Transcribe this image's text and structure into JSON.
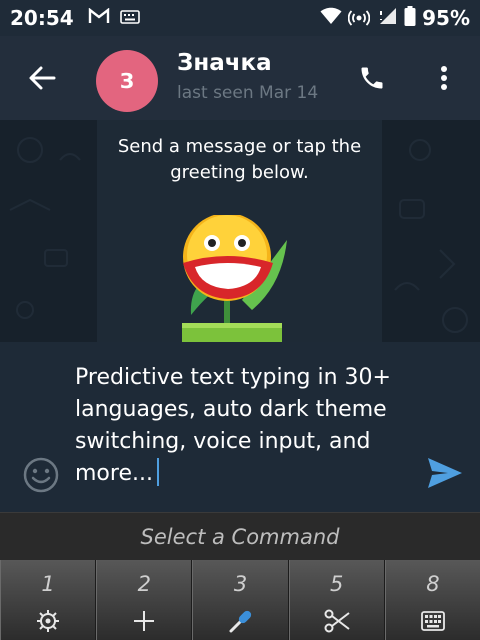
{
  "status_bar": {
    "time": "20:54",
    "battery": "95%",
    "icons": [
      "gmail-icon",
      "keyboard-icon",
      "wifi-icon",
      "hotspot-icon",
      "signal-icon",
      "battery-icon"
    ]
  },
  "header": {
    "avatar_initial": "З",
    "contact_name": "Значка",
    "last_seen": "last seen Mar 14",
    "avatar_color": "#e3657f"
  },
  "chat": {
    "empty_hint": "Send a message or tap the greeting below."
  },
  "compose": {
    "message_text": "Predictive text typing in 30+ languages, auto dark theme switching, voice input, and more...",
    "send_color": "#4f9fe0"
  },
  "command_bar": {
    "label": "Select a Command"
  },
  "keypad": {
    "keys": [
      {
        "number": "1",
        "icon": "settings-icon"
      },
      {
        "number": "2",
        "icon": "plus-icon"
      },
      {
        "number": "3",
        "icon": "microphone-icon"
      },
      {
        "number": "5",
        "icon": "scissors-icon"
      },
      {
        "number": "8",
        "icon": "keyboard-icon"
      }
    ]
  }
}
